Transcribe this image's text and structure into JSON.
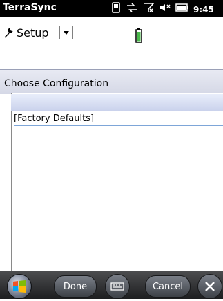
{
  "status_bar": {
    "app_title": "TerraSync",
    "time": "9:45",
    "icons": [
      "phone-icon",
      "sync-arrows-icon",
      "no-signal-icon",
      "volume-icon",
      "battery-icon"
    ]
  },
  "toolbar": {
    "menu_label": "Setup",
    "menu_icon": "wrench-icon",
    "dropdown_icon": "chevron-down-icon",
    "battery_indicator": "battery-icon"
  },
  "main": {
    "section_title": "Choose Configuration",
    "list": {
      "items": [
        "[Factory Defaults]"
      ]
    }
  },
  "bottom_bar": {
    "done_label": "Done",
    "cancel_label": "Cancel",
    "icons": [
      "windows-start-icon",
      "keyboard-icon",
      "close-icon"
    ]
  },
  "colors": {
    "status_bar_bg": "#000000",
    "section_bg": "#dde1ee",
    "list_header_bg": "#d7def2",
    "bottom_bar_bg": "#2b2c2e"
  }
}
